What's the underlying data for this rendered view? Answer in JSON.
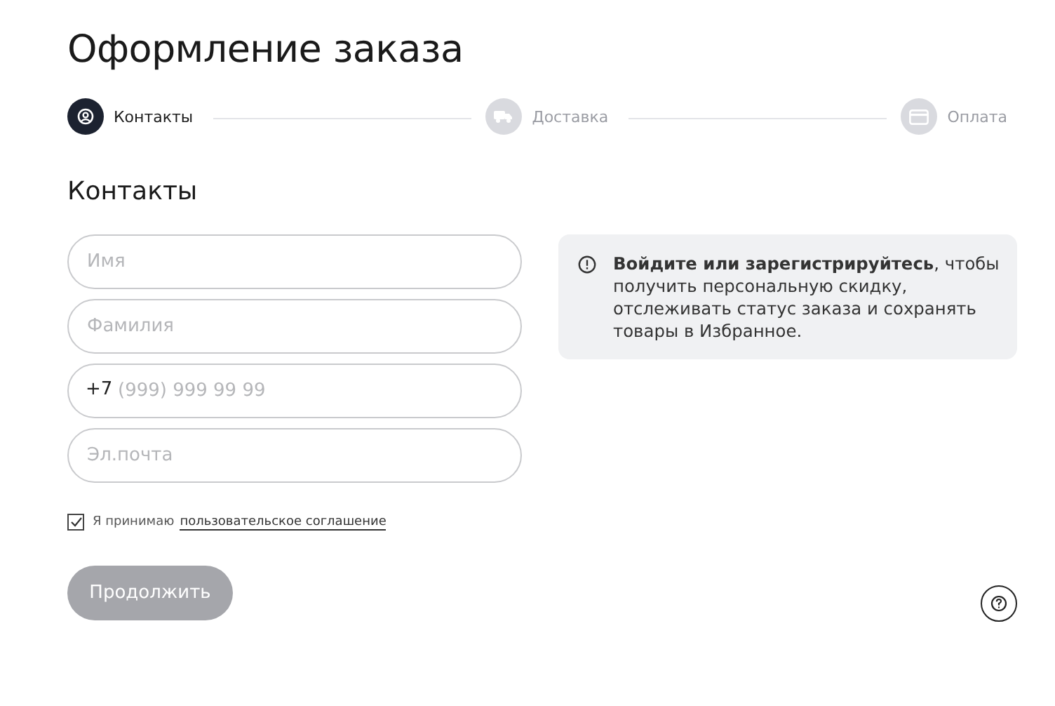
{
  "title": "Оформление заказа",
  "steps": [
    {
      "label": "Контакты",
      "kind": "person",
      "selected": true
    },
    {
      "label": "Доставка",
      "kind": "truck",
      "selected": false
    },
    {
      "label": "Оплата",
      "kind": "card",
      "selected": false
    }
  ],
  "section_title": "Контакты",
  "fields": [
    {
      "placeholder": "Имя"
    },
    {
      "placeholder": "Фамилия"
    },
    {
      "prefix": "+7",
      "placeholder": "(999) 999 99 99"
    },
    {
      "placeholder": "Эл.почта"
    }
  ],
  "agreement": {
    "checked": true,
    "text": "Я принимаю",
    "link": "пользовательское соглашение"
  },
  "submit": {
    "label": "Продолжить",
    "disabled": true
  },
  "notice": {
    "text": "**Войдите или зарегистрируйтесь**, чтобы получить персональную скидку, отслеживать статус заказа и сохранять товары в Избранное."
  }
}
